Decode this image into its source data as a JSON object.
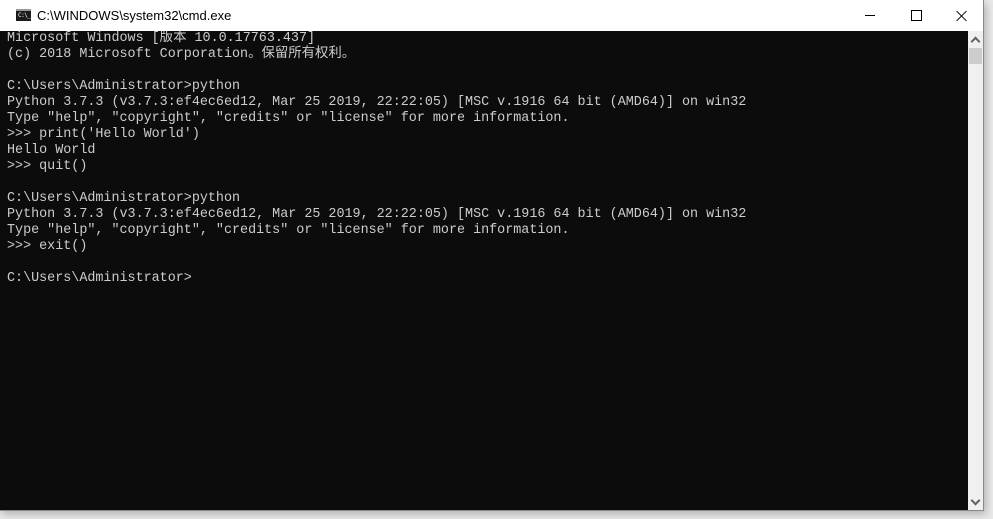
{
  "window": {
    "title": "C:\\WINDOWS\\system32\\cmd.exe",
    "app_icon_label": "C:\\_",
    "controls": {
      "minimize": "minimize",
      "maximize": "maximize",
      "close": "close"
    }
  },
  "console": {
    "lines": [
      "Microsoft Windows [版本 10.0.17763.437]",
      "(c) 2018 Microsoft Corporation。保留所有权利。",
      "",
      "C:\\Users\\Administrator>python",
      "Python 3.7.3 (v3.7.3:ef4ec6ed12, Mar 25 2019, 22:22:05) [MSC v.1916 64 bit (AMD64)] on win32",
      "Type \"help\", \"copyright\", \"credits\" or \"license\" for more information.",
      ">>> print('Hello World')",
      "Hello World",
      ">>> quit()",
      "",
      "C:\\Users\\Administrator>python",
      "Python 3.7.3 (v3.7.3:ef4ec6ed12, Mar 25 2019, 22:22:05) [MSC v.1916 64 bit (AMD64)] on win32",
      "Type \"help\", \"copyright\", \"credits\" or \"license\" for more information.",
      ">>> exit()",
      "",
      "C:\\Users\\Administrator>"
    ]
  },
  "scrollbar": {
    "position_fraction": 0
  },
  "colors": {
    "console_bg": "#0c0c0c",
    "console_fg": "#cccccc",
    "titlebar_bg": "#ffffff",
    "scrollbar_bg": "#f0f0f0",
    "scrollbar_thumb": "#cdcdcd"
  }
}
